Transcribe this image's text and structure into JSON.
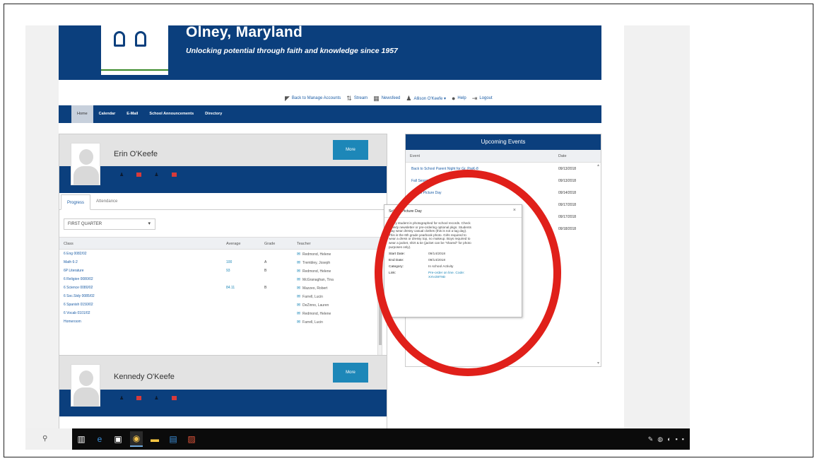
{
  "school": {
    "name": "Olney, Maryland",
    "motto": "Unlocking potential through faith and knowledge since 1957"
  },
  "utility_links": [
    {
      "label": "Back to Manage Accounts",
      "icon": "back-arrow-icon"
    },
    {
      "label": "Stream",
      "icon": "stream-icon"
    },
    {
      "label": "Newsfeed",
      "icon": "newsfeed-icon"
    },
    {
      "label": "Allison O'Keefe ▾",
      "icon": "user-icon"
    },
    {
      "label": "Help",
      "icon": "help-icon"
    },
    {
      "label": "Logout",
      "icon": "logout-icon"
    }
  ],
  "nav": [
    "Home",
    "Calendar",
    "E-Mail",
    "School Announcements",
    "Directory"
  ],
  "student1": {
    "name": "Erin O'Keefe",
    "more_label": "More",
    "tabs": [
      "Progress",
      "Attendance"
    ],
    "quarter": "FIRST QUARTER",
    "columns": [
      "Class",
      "Average",
      "Grade",
      "Teacher"
    ],
    "rows": [
      {
        "class": "6 Eng 0082/02",
        "avg": "",
        "grade": "",
        "teacher": "Redmond, Helene"
      },
      {
        "class": "Math 6-2",
        "avg": "100",
        "grade": "A",
        "teacher": "Trembley, Joseph"
      },
      {
        "class": "6P Literature",
        "avg": "93",
        "grade": "B",
        "teacher": "Redmond, Helene"
      },
      {
        "class": "6 Religion 0080/02",
        "avg": "",
        "grade": "",
        "teacher": "McGranaghan, Tina"
      },
      {
        "class": "6 Science 0080/02",
        "avg": "84.11",
        "grade": "B",
        "teacher": "Mazzeo, Robert"
      },
      {
        "class": "6 Soc.Stdy 0085/02",
        "avg": "",
        "grade": "",
        "teacher": "Farrell, Lucin"
      },
      {
        "class": "6 Spanish 0150/02",
        "avg": "",
        "grade": "",
        "teacher": "DeZinno, Lauren"
      },
      {
        "class": "6 Vocab 0101/02",
        "avg": "",
        "grade": "",
        "teacher": "Redmond, Helene"
      },
      {
        "class": "Homeroom",
        "avg": "",
        "grade": "",
        "teacher": "Farrell, Lucin"
      }
    ]
  },
  "student2": {
    "name": "Kennedy O'Keefe",
    "more_label": "More"
  },
  "events": {
    "title": "Upcoming Events",
    "columns": [
      "Event",
      "Date"
    ],
    "rows": [
      {
        "event": "Back to School Parent Night for Gr. PreK-8",
        "date": "09/13/2018"
      },
      {
        "event": "Fall Session 1",
        "date": "09/13/2018"
      },
      {
        "event": "School Picture Day",
        "date": "09/14/2018"
      },
      {
        "event": "",
        "date": "09/17/2018"
      },
      {
        "event": "",
        "date": "09/17/2018"
      },
      {
        "event": "",
        "date": "09/18/2018"
      }
    ]
  },
  "popover": {
    "title": "School Picture Day",
    "description": "Every student is photographed for school records. Check weekly newsletter or pre-ordering optional pkgs. Students may wear dressy casual clothes (this is not a tag day). This is the 6th grade yearbook photo. Girls required to wear a dress or dressy top, no makeup. Boys required to wear a jacket, shirt & tie (jacket can be \"shared\" for photo purposes only).",
    "fields": [
      {
        "key": "Start Date:",
        "value": "09/14/2018"
      },
      {
        "key": "End Date:",
        "value": "09/14/2018"
      },
      {
        "key": "Category:",
        "value": "In school Activity"
      },
      {
        "key": "Link:",
        "value": "Pre-order on line. Code: XXVZ8T9D"
      }
    ]
  },
  "annotation_color": "#e0201a",
  "brand_color": "#0b3f7d"
}
